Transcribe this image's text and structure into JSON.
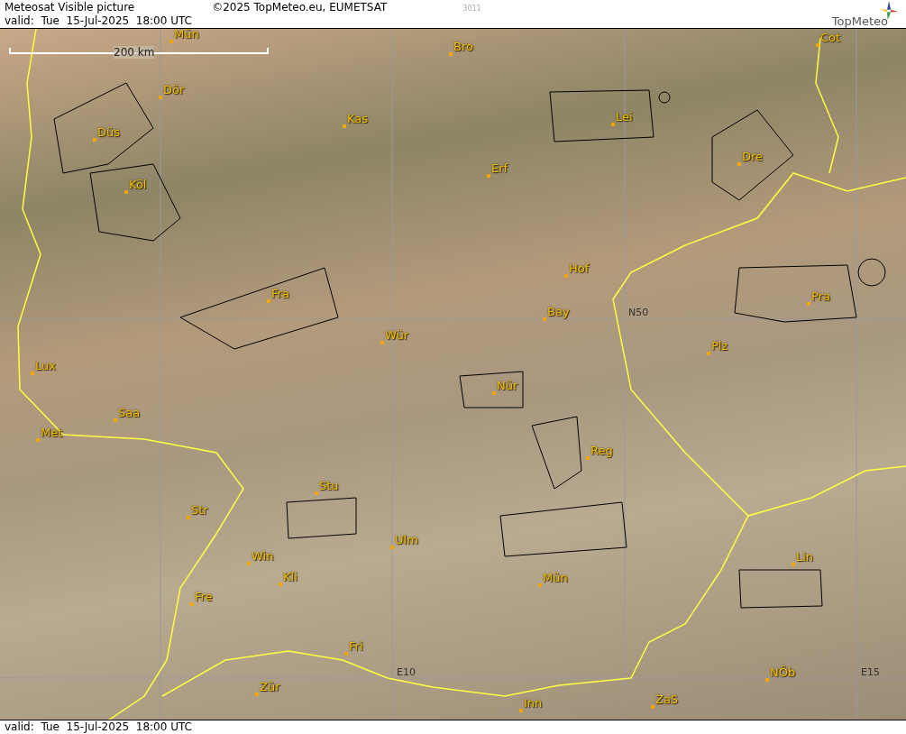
{
  "header": {
    "title": "Meteosat Visible picture",
    "copyright": "©2025 TopMeteo.eu, EUMETSAT",
    "code": "3011",
    "valid": "valid:  Tue  15-Jul-2025  18:00 UTC",
    "logo": "TopMeteo"
  },
  "map": {
    "scale": "200 km",
    "cities": [
      "Mün",
      "Bro",
      "Dör",
      "Kas",
      "Düs",
      "Lei",
      "Cot",
      "Erf",
      "Köl",
      "Dre",
      "Hof",
      "Fra",
      "Pra",
      "Bay",
      "Wür",
      "Plz",
      "Lux",
      "Nür",
      "Saa",
      "Met",
      "Reg",
      "Stu",
      "Str",
      "Ulm",
      "Win",
      "Lin",
      "Kli",
      "Mün",
      "Fre",
      "Fri",
      "NÖb",
      "Zür",
      "ZaS",
      "Inn"
    ],
    "grid_labels": [
      "N50",
      "E10",
      "E15"
    ]
  },
  "footer": {
    "valid": "valid:  Tue  15-Jul-2025  18:00 UTC"
  }
}
